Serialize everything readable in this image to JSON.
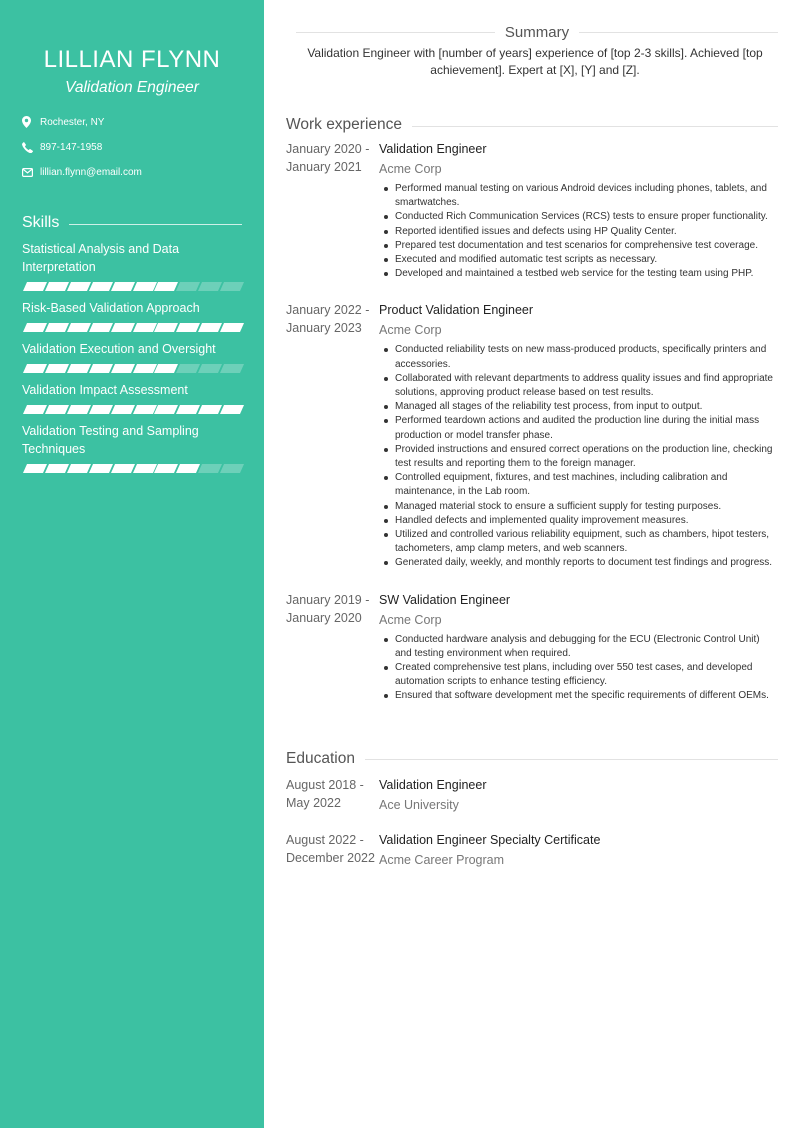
{
  "profile": {
    "name": "LILLIAN FLYNN",
    "headline": "Validation Engineer",
    "contacts": [
      {
        "icon": "location-pin-icon",
        "text": "Rochester, NY"
      },
      {
        "icon": "phone-icon",
        "text": "897-147-1958"
      },
      {
        "icon": "envelope-icon",
        "text": "lillian.flynn@email.com"
      }
    ]
  },
  "skills": {
    "title": "Skills",
    "scale": 10,
    "items": [
      {
        "label": "Statistical Analysis and Data Interpretation",
        "level": 7
      },
      {
        "label": "Risk-Based Validation Approach",
        "level": 10
      },
      {
        "label": "Validation Execution and Oversight",
        "level": 7
      },
      {
        "label": "Validation Impact Assessment",
        "level": 10
      },
      {
        "label": "Validation Testing and Sampling Techniques",
        "level": 8
      }
    ]
  },
  "summary": {
    "title": "Summary",
    "text": "Validation Engineer with [number of years] experience of [top 2-3 skills]. Achieved [top achievement]. Expert at [X], [Y] and [Z]."
  },
  "work": {
    "title": "Work experience",
    "jobs": [
      {
        "dates": [
          "January 2020 -",
          "January 2021"
        ],
        "role": "Validation Engineer",
        "company": "Acme Corp",
        "bullets": [
          "Performed manual testing on various Android devices including phones, tablets, and smartwatches.",
          "Conducted Rich Communication Services (RCS) tests to ensure proper functionality.",
          "Reported identified issues and defects using HP Quality Center.",
          "Prepared test documentation and test scenarios for comprehensive test coverage.",
          "Executed and modified automatic test scripts as necessary.",
          "Developed and maintained a testbed web service for the testing team using PHP."
        ]
      },
      {
        "dates": [
          "January 2022 -",
          "January 2023"
        ],
        "role": "Product Validation Engineer",
        "company": "Acme Corp",
        "bullets": [
          "Conducted reliability tests on new mass-produced products, specifically printers and accessories.",
          "Collaborated with relevant departments to address quality issues and find appropriate solutions, approving product release based on test results.",
          "Managed all stages of the reliability test process, from input to output.",
          "Performed teardown actions and audited the production line during the initial mass production or model transfer phase.",
          "Provided instructions and ensured correct operations on the production line, checking test results and reporting them to the foreign manager.",
          "Controlled equipment, fixtures, and test machines, including calibration and maintenance, in the Lab room.",
          "Managed material stock to ensure a sufficient supply for testing purposes.",
          "Handled defects and implemented quality improvement measures.",
          "Utilized and controlled various reliability equipment, such as chambers, hipot testers, tachometers, amp clamp meters, and web scanners.",
          "Generated daily, weekly, and monthly reports to document test findings and progress."
        ]
      },
      {
        "dates": [
          "January 2019 -",
          "January 2020"
        ],
        "role": "SW Validation Engineer",
        "company": "Acme Corp",
        "bullets": [
          "Conducted hardware analysis and debugging for the ECU (Electronic Control Unit) and testing environment when required.",
          "Created comprehensive test plans, including over 550 test cases, and developed automation scripts to enhance testing efficiency.",
          "Ensured that software development met the specific requirements of different OEMs."
        ]
      }
    ]
  },
  "education": {
    "title": "Education",
    "items": [
      {
        "dates": [
          "August 2018 -",
          "May 2022"
        ],
        "degree": "Validation Engineer",
        "school": "Ace University"
      },
      {
        "dates": [
          "August 2022 -",
          "December 2022"
        ],
        "degree": "Validation Engineer Specialty Certificate",
        "school": "Acme Career Program"
      }
    ]
  },
  "colors": {
    "sidebar": "#3cc1a2",
    "text": "#333333"
  }
}
